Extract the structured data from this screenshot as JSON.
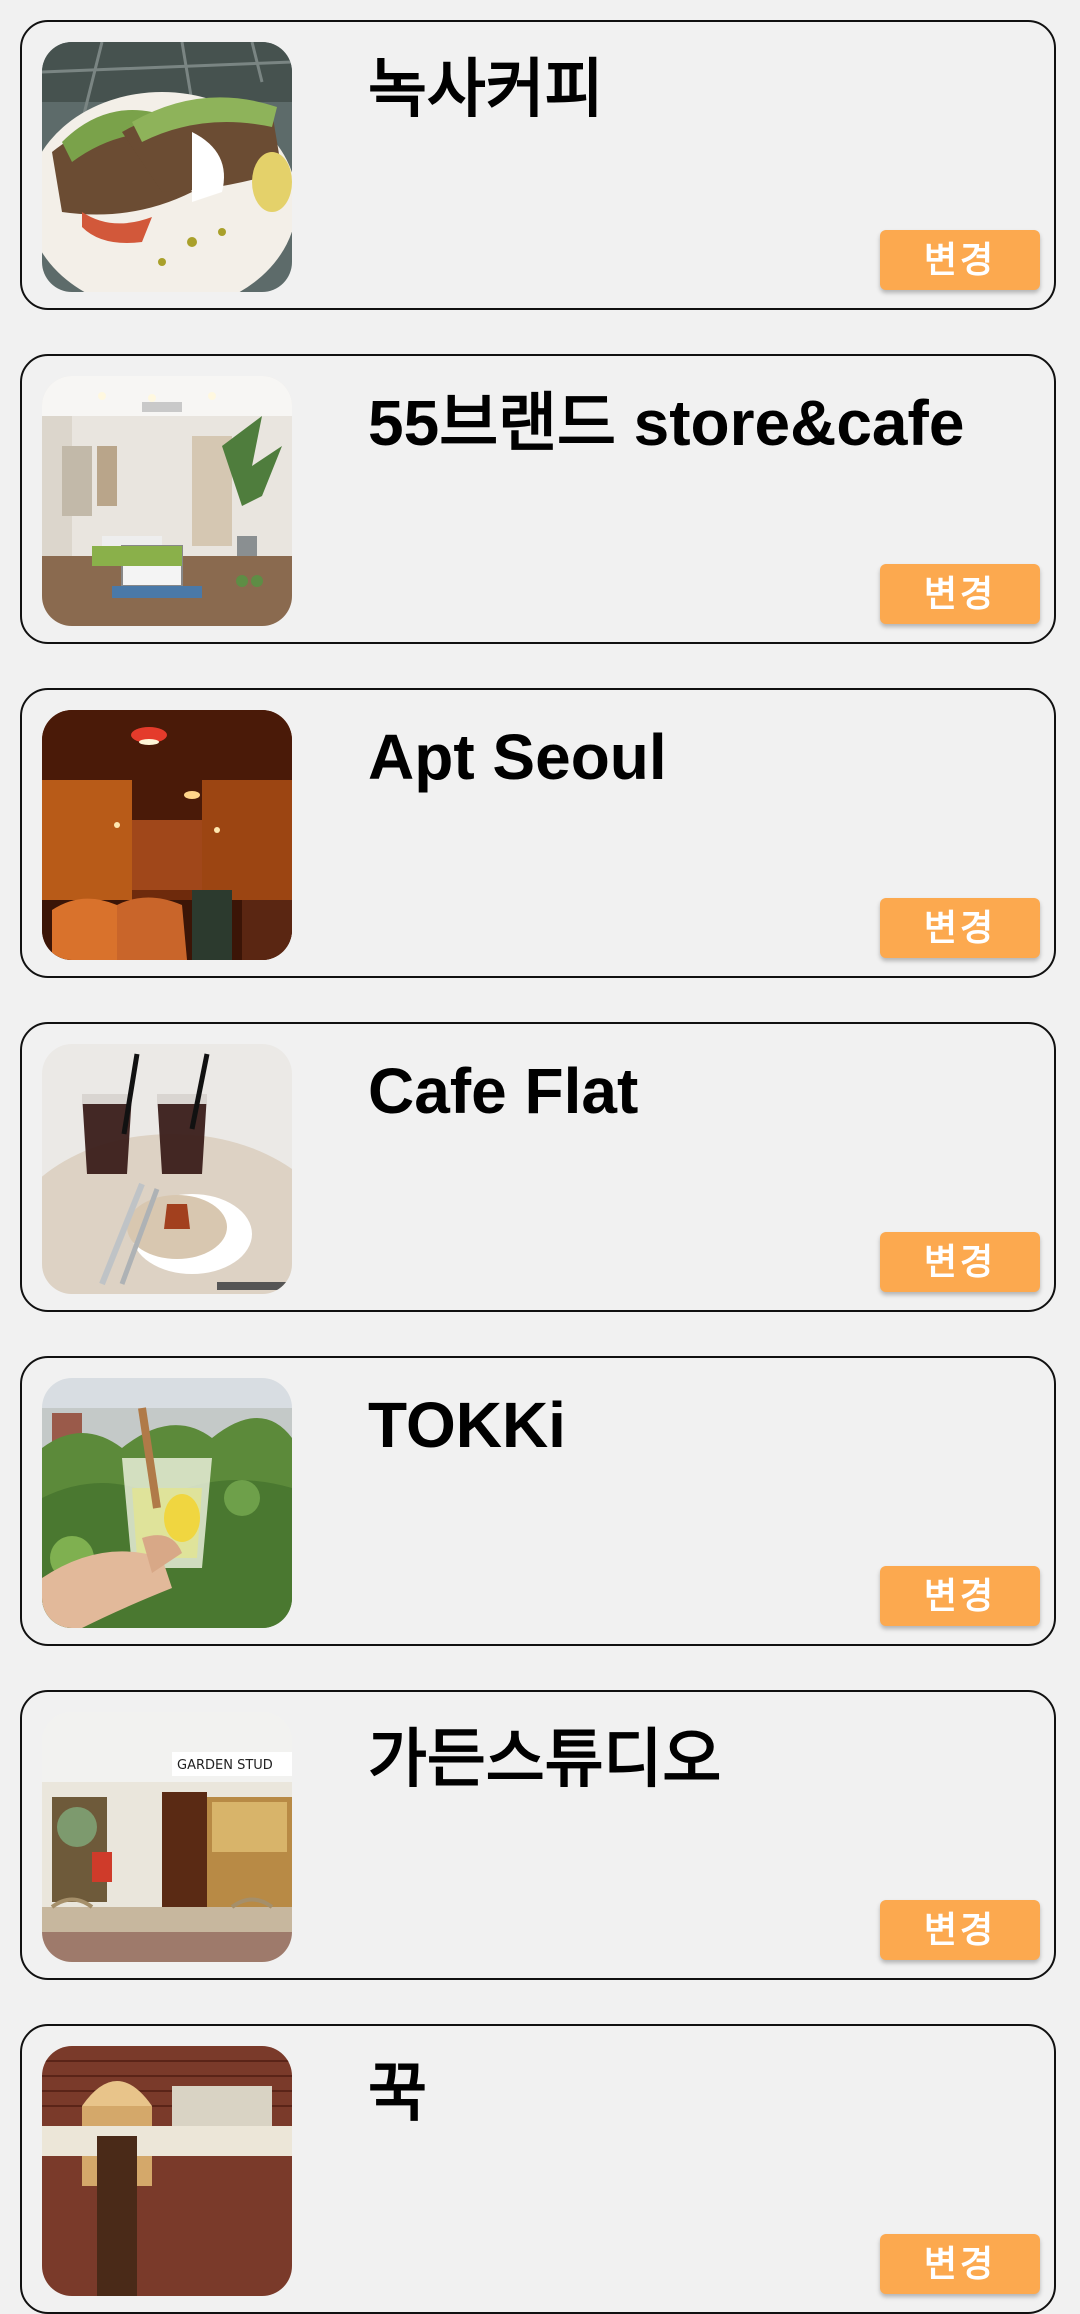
{
  "cafes": [
    {
      "name": "녹사커피",
      "button": "변경",
      "photo_icon": "avocado-toast-photo"
    },
    {
      "name": "55브랜드 store&cafe",
      "button": "변경",
      "photo_icon": "store-interior-photo"
    },
    {
      "name": "Apt Seoul",
      "button": "변경",
      "photo_icon": "red-interior-photo"
    },
    {
      "name": "Cafe Flat",
      "button": "변경",
      "photo_icon": "iced-coffee-photo"
    },
    {
      "name": "TOKKi",
      "button": "변경",
      "photo_icon": "lemonade-drink-photo"
    },
    {
      "name": "가든스튜디오",
      "button": "변경",
      "photo_icon": "storefront-photo",
      "photo_sign": "GARDEN STUD"
    },
    {
      "name": "꾹",
      "button": "변경",
      "photo_icon": "brick-building-photo"
    }
  ],
  "colors": {
    "background": "#f1f1f1",
    "button": "#fca94f",
    "border": "#111111"
  }
}
